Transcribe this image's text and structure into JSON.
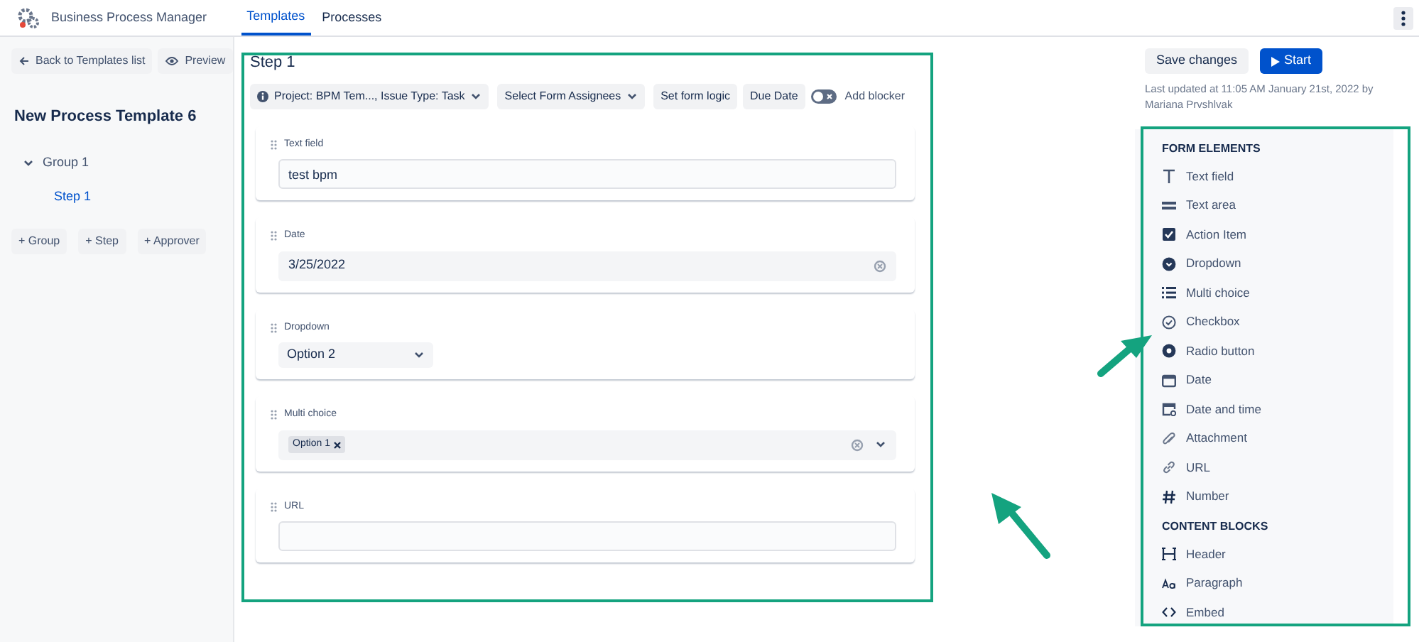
{
  "app": {
    "title": "Business Process Manager",
    "tabs": [
      {
        "label": "Templates",
        "selected": true
      },
      {
        "label": "Processes",
        "selected": false
      }
    ]
  },
  "sidebar": {
    "back": "Back to Templates list",
    "preview": "Preview",
    "title": "New Process Template 6",
    "tree": [
      {
        "label": "Group 1",
        "expanded": true,
        "children": [
          {
            "label": "Step 1",
            "selected": true
          }
        ]
      }
    ],
    "add_buttons": [
      "+ Group",
      "+ Step",
      "+ Approver"
    ]
  },
  "step": {
    "title": "Step 1",
    "toolbar": [
      {
        "kind": "dropdown",
        "label": "Project: BPM Tem..., Issue Type: Task",
        "info": true
      },
      {
        "kind": "dropdown",
        "label": "Select Form Assignees",
        "info": false
      },
      {
        "kind": "button",
        "label": "Set form logic"
      },
      {
        "kind": "button",
        "label": "Due Date"
      },
      {
        "kind": "toggle",
        "label": "Add blocker",
        "on": false
      }
    ],
    "fields": [
      {
        "kind": "text",
        "label": "Text field",
        "value": "test bpm"
      },
      {
        "kind": "date",
        "label": "Date",
        "value": "3/25/2022"
      },
      {
        "kind": "select",
        "label": "Dropdown",
        "value": "Option 2"
      },
      {
        "kind": "multi",
        "label": "Multi choice",
        "tags": [
          "Option 1"
        ]
      },
      {
        "kind": "text",
        "label": "URL"
      }
    ]
  },
  "actions": {
    "save": "Save changes",
    "start": "Start",
    "last_updated": "Last updated at 11:05 AM January 21st, 2022 by Mariana Prvshlvak"
  },
  "palette": [
    {
      "title": "FORM ELEMENTS",
      "items": [
        {
          "kind": "text",
          "label": "Text field"
        },
        {
          "kind": "textarea",
          "label": "Text area"
        },
        {
          "kind": "action",
          "label": "Action Item"
        },
        {
          "kind": "dropdown",
          "label": "Dropdown"
        },
        {
          "kind": "multi",
          "label": "Multi choice"
        },
        {
          "kind": "checkbox",
          "label": "Checkbox"
        },
        {
          "kind": "radio",
          "label": "Radio button"
        },
        {
          "kind": "date",
          "label": "Date"
        },
        {
          "kind": "datetime",
          "label": "Date and time"
        },
        {
          "kind": "attachment",
          "label": "Attachment"
        },
        {
          "kind": "url",
          "label": "URL"
        },
        {
          "kind": "number",
          "label": "Number"
        }
      ]
    },
    {
      "title": "CONTENT BLOCKS",
      "items": [
        {
          "kind": "header",
          "label": "Header"
        },
        {
          "kind": "paragraph",
          "label": "Paragraph"
        },
        {
          "kind": "embed",
          "label": "Embed"
        }
      ]
    }
  ]
}
